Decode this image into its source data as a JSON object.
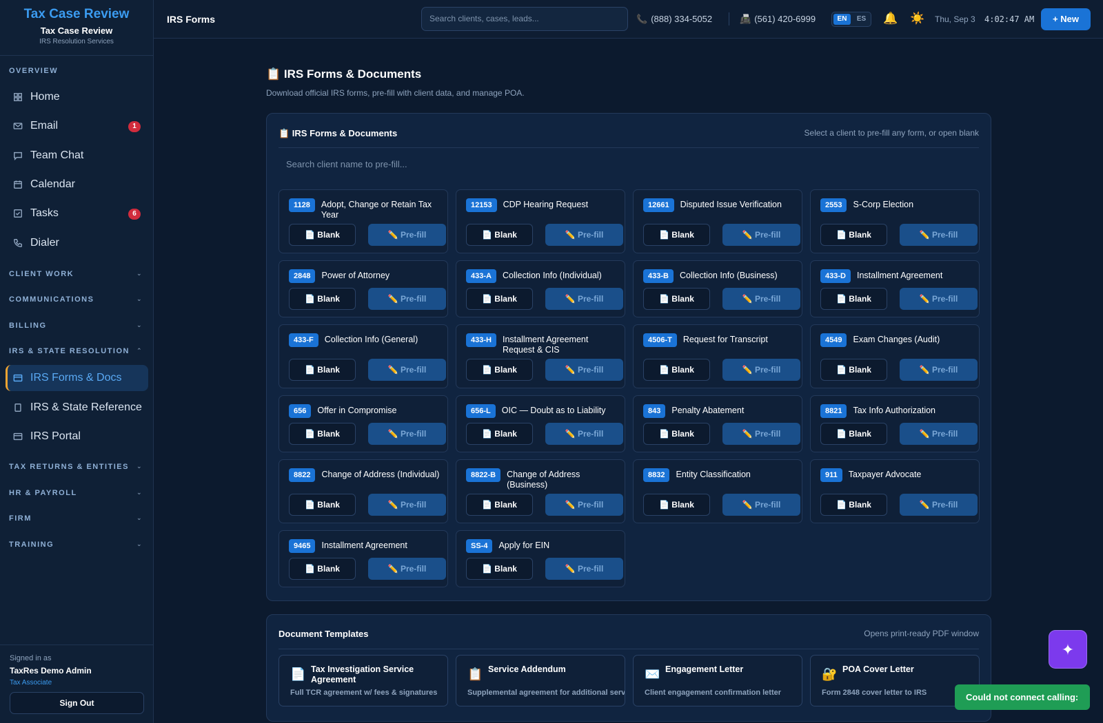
{
  "brand": {
    "logo": "Tax Case Review",
    "title": "Tax Case Review",
    "subtitle": "IRS Resolution Services"
  },
  "sidebar": {
    "overview_label": "OVERVIEW",
    "overview_items": [
      {
        "label": "Home",
        "icon": "home-grid-icon"
      },
      {
        "label": "Email",
        "icon": "mail-icon",
        "badge": "1"
      },
      {
        "label": "Team Chat",
        "icon": "chat-icon"
      },
      {
        "label": "Calendar",
        "icon": "calendar-icon"
      },
      {
        "label": "Tasks",
        "icon": "checkbox-icon",
        "badge": "6"
      },
      {
        "label": "Dialer",
        "icon": "phone-icon"
      }
    ],
    "sections": {
      "client_work": "CLIENT WORK",
      "communications": "COMMUNICATIONS",
      "billing": "BILLING",
      "irs_state": "IRS & STATE RESOLUTION",
      "tax_returns": "TAX RETURNS & ENTITIES",
      "hr_payroll": "HR & PAYROLL",
      "firm": "FIRM",
      "training": "TRAINING"
    },
    "irs_items": [
      {
        "label": "IRS Forms & Docs",
        "icon": "card-icon",
        "active": true
      },
      {
        "label": "IRS & State Reference",
        "icon": "book-icon"
      },
      {
        "label": "IRS Portal",
        "icon": "card-icon"
      }
    ],
    "signed_in_label": "Signed in as",
    "user_name": "TaxRes Demo Admin",
    "user_role": "Tax Associate",
    "sign_out": "Sign Out"
  },
  "topbar": {
    "title": "IRS Forms",
    "search_placeholder": "Search clients, cases, leads...",
    "phone": "(888) 334-5052",
    "fax": "(561) 420-6999",
    "lang_en": "EN",
    "lang_es": "ES",
    "date": "Thu, Sep 3",
    "time": "4:02:47 AM",
    "new_button": "+ New"
  },
  "page": {
    "heading": "📋 IRS Forms & Documents",
    "subheading": "Download official IRS forms, pre-fill with client data, and manage POA."
  },
  "forms_panel": {
    "title": "📋 IRS Forms & Documents",
    "hint": "Select a client to pre-fill any form, or open blank",
    "client_search_placeholder": "Search client name to pre-fill...",
    "blank_label": "📄 Blank",
    "prefill_label": "✏️ Pre-fill",
    "forms": [
      {
        "num": "1128",
        "name": "Adopt, Change or Retain Tax Year"
      },
      {
        "num": "12153",
        "name": "CDP Hearing Request"
      },
      {
        "num": "12661",
        "name": "Disputed Issue Verification"
      },
      {
        "num": "2553",
        "name": "S-Corp Election"
      },
      {
        "num": "2848",
        "name": "Power of Attorney"
      },
      {
        "num": "433-A",
        "name": "Collection Info (Individual)"
      },
      {
        "num": "433-B",
        "name": "Collection Info (Business)"
      },
      {
        "num": "433-D",
        "name": "Installment Agreement"
      },
      {
        "num": "433-F",
        "name": "Collection Info (General)"
      },
      {
        "num": "433-H",
        "name": "Installment Agreement Request & CIS"
      },
      {
        "num": "4506-T",
        "name": "Request for Transcript"
      },
      {
        "num": "4549",
        "name": "Exam Changes (Audit)"
      },
      {
        "num": "656",
        "name": "Offer in Compromise"
      },
      {
        "num": "656-L",
        "name": "OIC — Doubt as to Liability"
      },
      {
        "num": "843",
        "name": "Penalty Abatement"
      },
      {
        "num": "8821",
        "name": "Tax Info Authorization"
      },
      {
        "num": "8822",
        "name": "Change of Address (Individual)"
      },
      {
        "num": "8822-B",
        "name": "Change of Address (Business)"
      },
      {
        "num": "8832",
        "name": "Entity Classification"
      },
      {
        "num": "911",
        "name": "Taxpayer Advocate"
      },
      {
        "num": "9465",
        "name": "Installment Agreement"
      },
      {
        "num": "SS-4",
        "name": "Apply for EIN"
      }
    ]
  },
  "templates_panel": {
    "title": "Document Templates",
    "hint": "Opens print-ready PDF window",
    "templates": [
      {
        "icon": "📄",
        "title": "Tax Investigation Service Agreement",
        "desc": "Full TCR agreement w/ fees & signatures"
      },
      {
        "icon": "📋",
        "title": "Service Addendum",
        "desc": "Supplemental agreement for additional services"
      },
      {
        "icon": "✉️",
        "title": "Engagement Letter",
        "desc": "Client engagement confirmation letter"
      },
      {
        "icon": "🔐",
        "title": "POA Cover Letter",
        "desc": "Form 2848 cover letter to IRS"
      }
    ]
  },
  "fab_icon": "✦",
  "toast": "Could not connect calling:"
}
